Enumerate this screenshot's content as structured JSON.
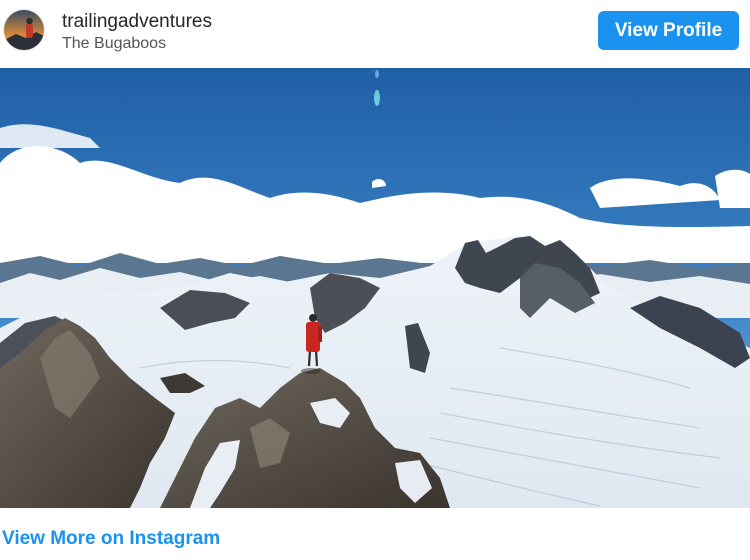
{
  "post": {
    "username": "trailingadventures",
    "location": "The Bugaboos",
    "avatar_icon": "profile-avatar",
    "view_profile_label": "View Profile",
    "image_description_icon": "mountain-photo",
    "footer_link_label": "View More on Instagram"
  },
  "colors": {
    "accent": "#1a92ef",
    "username": "#262626",
    "secondary": "#555555"
  }
}
